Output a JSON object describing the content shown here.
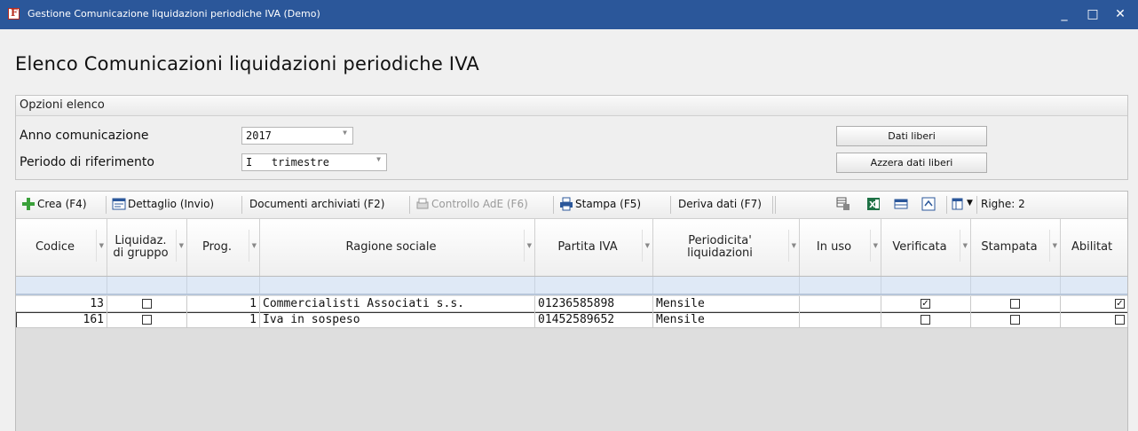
{
  "window": {
    "title": "Gestione Comunicazione liquidazioni periodiche IVA  (Demo)",
    "minimize_glyph": "_",
    "maximize_glyph": "□",
    "close_glyph": "✕"
  },
  "page_title": "Elenco Comunicazioni liquidazioni periodiche IVA",
  "options": {
    "header": "Opzioni elenco",
    "anno_label": "Anno comunicazione",
    "anno_value": "2017",
    "periodo_label": "Periodo di riferimento",
    "periodo_value": "I   trimestre",
    "dati_liberi_button": "Dati liberi",
    "azzera_button": "Azzera dati liberi"
  },
  "toolbar": {
    "crea": "Crea (F4)",
    "dettaglio": "Dettaglio (Invio)",
    "documenti": "Documenti archiviati (F2)",
    "controllo": "Controllo AdE (F6)",
    "stampa": "Stampa (F5)",
    "deriva": "Deriva dati (F7)",
    "righe": "Righe: 2",
    "icons": [
      "add-icon",
      "detail-icon",
      "scan-icon",
      "printer-icon",
      "export-icon",
      "excel-icon",
      "grid-icon",
      "refresh-icon",
      "columns-icon"
    ],
    "colors": {
      "add": "#3aa03a",
      "excel": "#1e7145",
      "accent": "#2b579a"
    }
  },
  "columns": {
    "codice": "Codice",
    "liquidaz": "Liquidaz. di gruppo",
    "prog": "Prog.",
    "ragione": "Ragione sociale",
    "partita": "Partita IVA",
    "periodicita": "Periodicita' liquidazioni",
    "inuso": "In uso",
    "verificata": "Verificata",
    "stampata": "Stampata",
    "abilitat": "Abilitat"
  },
  "rows": [
    {
      "codice": "13",
      "liquidaz": false,
      "prog": "1",
      "ragione": "Commercialisti Associati s.s.",
      "partita": "01236585898",
      "periodicita": "Mensile",
      "inuso": "",
      "verificata": true,
      "stampata": false,
      "abilitat": true
    },
    {
      "codice": "161",
      "liquidaz": false,
      "prog": "1",
      "ragione": "Iva in sospeso",
      "partita": "01452589652",
      "periodicita": "Mensile",
      "inuso": "",
      "verificata": false,
      "stampata": false,
      "abilitat": false
    }
  ]
}
